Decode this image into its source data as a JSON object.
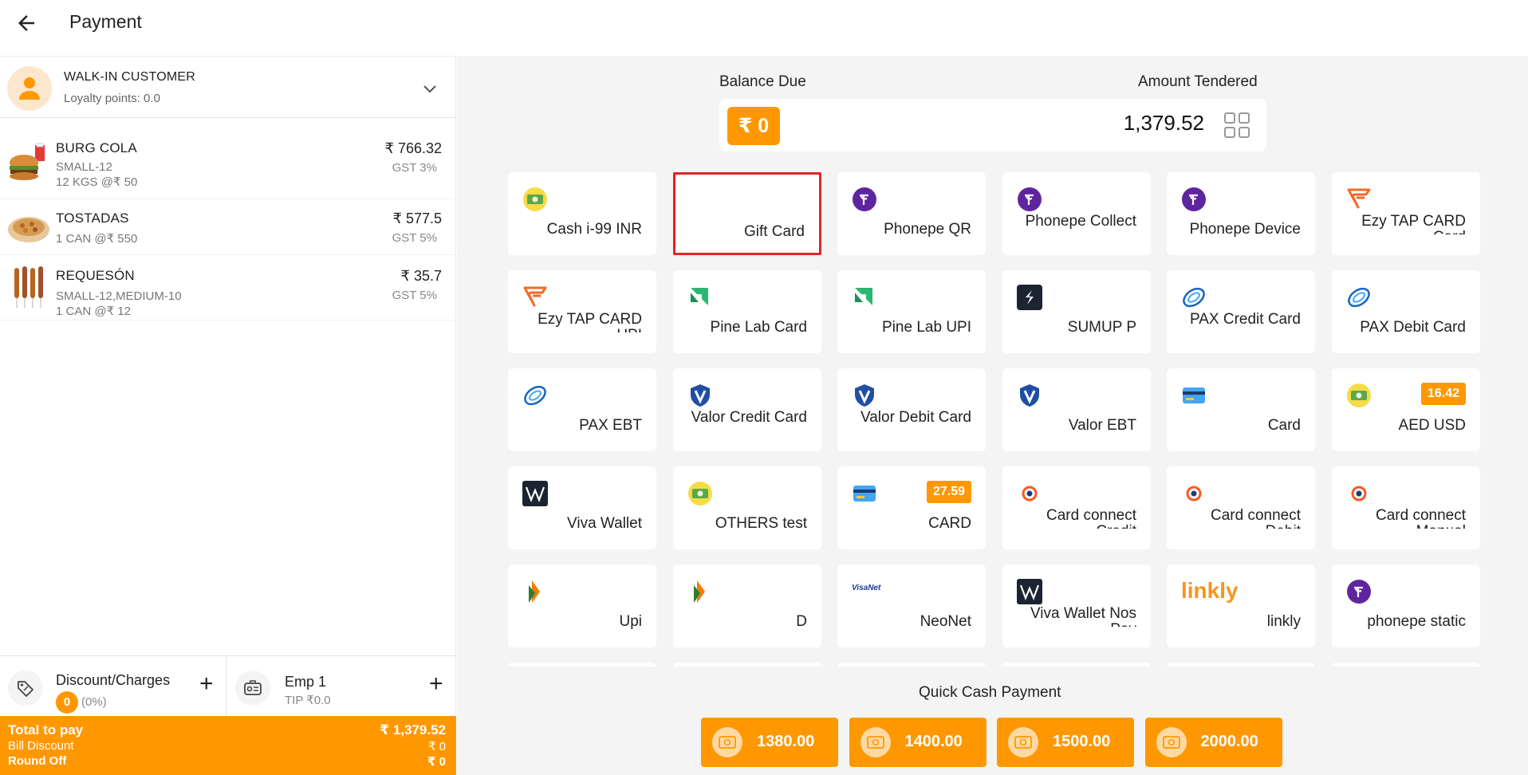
{
  "header": {
    "title": "Payment"
  },
  "customer": {
    "name": "WALK-IN CUSTOMER",
    "loyalty": "Loyalty points: 0.0"
  },
  "items": [
    {
      "name": "BURG COLA",
      "sub1": "SMALL-12",
      "sub2": "12 KGS @₹ 50",
      "price": "₹ 766.32",
      "gst": "GST 3%"
    },
    {
      "name": "TOSTADAS",
      "sub1": "1 CAN @₹ 550",
      "sub2": "",
      "price": "₹ 577.5",
      "gst": "GST 5%"
    },
    {
      "name": "REQUESÓN",
      "sub1": "SMALL-12,MEDIUM-10",
      "sub2": "1 CAN @₹ 12",
      "price": "₹ 35.7",
      "gst": "GST 5%"
    }
  ],
  "discount": {
    "label": "Discount/Charges",
    "count": "0",
    "percent": "(0%)"
  },
  "employee": {
    "name": "Emp 1",
    "tip": "TIP ₹0.0"
  },
  "totals": {
    "total_label": "Total to pay",
    "total_value": "₹ 1,379.52",
    "discount_label": "Bill Discount",
    "discount_value": "₹ 0",
    "roundoff_label": "Round Off",
    "roundoff_value": "₹ 0"
  },
  "tender": {
    "balance_label": "Balance Due",
    "balance_value": "₹ 0",
    "tendered_label": "Amount Tendered",
    "tendered_value": "1,379.52"
  },
  "methods": [
    {
      "label": "Cash i-99 INR",
      "icon": "cash-icon",
      "selected": false
    },
    {
      "label": "Gift Card",
      "icon": "",
      "selected": true
    },
    {
      "label": "Phonepe QR",
      "icon": "phonepe-icon",
      "selected": false
    },
    {
      "label": "Phonepe Collect",
      "icon": "phonepe-icon",
      "selected": false
    },
    {
      "label": "Phonepe Device",
      "icon": "phonepe-icon",
      "selected": false
    },
    {
      "label": "Ezy TAP CARD Card",
      "icon": "ezytap-icon",
      "selected": false
    },
    {
      "label": "Ezy TAP CARD UPI",
      "icon": "ezytap-icon",
      "selected": false
    },
    {
      "label": "Pine Lab Card",
      "icon": "pinelab-icon",
      "selected": false
    },
    {
      "label": "Pine Lab UPI",
      "icon": "pinelab-icon",
      "selected": false
    },
    {
      "label": "SUMUP P",
      "icon": "sumup-icon",
      "selected": false
    },
    {
      "label": "PAX Credit Card",
      "icon": "pax-icon",
      "selected": false
    },
    {
      "label": "PAX Debit Card",
      "icon": "pax-icon",
      "selected": false
    },
    {
      "label": "PAX EBT",
      "icon": "pax-icon",
      "selected": false
    },
    {
      "label": "Valor Credit Card",
      "icon": "valor-icon",
      "selected": false
    },
    {
      "label": "Valor Debit Card",
      "icon": "valor-icon",
      "selected": false
    },
    {
      "label": "Valor EBT",
      "icon": "valor-icon",
      "selected": false
    },
    {
      "label": "Card",
      "icon": "card-icon",
      "selected": false
    },
    {
      "label": "AED USD",
      "icon": "cash-icon",
      "badge": "16.42",
      "selected": false
    },
    {
      "label": "Viva Wallet",
      "icon": "viva-icon",
      "selected": false
    },
    {
      "label": "OTHERS test",
      "icon": "cash-icon",
      "selected": false
    },
    {
      "label": "CARD",
      "icon": "card-icon",
      "badge": "27.59",
      "selected": false
    },
    {
      "label": "Card connect Credit",
      "icon": "cardconnect-icon",
      "selected": false
    },
    {
      "label": "Card connect Debit",
      "icon": "cardconnect-icon",
      "selected": false
    },
    {
      "label": "Card connect Manual",
      "icon": "cardconnect-icon",
      "selected": false
    },
    {
      "label": "Upi",
      "icon": "upi-icon",
      "selected": false
    },
    {
      "label": "D",
      "icon": "upi-icon",
      "selected": false
    },
    {
      "label": "NeoNet",
      "icon": "visanet-icon",
      "icon_text": "VisaNet",
      "selected": false
    },
    {
      "label": "Viva Wallet Nos Pay",
      "icon": "viva-icon",
      "selected": false
    },
    {
      "label": "linkly",
      "icon": "linkly-icon",
      "icon_text": "linkly",
      "selected": false
    },
    {
      "label": "phonepe static",
      "icon": "phonepe-icon",
      "selected": false
    }
  ],
  "quick_cash": {
    "title": "Quick Cash Payment",
    "amounts": [
      "1380.00",
      "1400.00",
      "1500.00",
      "2000.00"
    ]
  },
  "colors": {
    "accent": "#ff9800",
    "selected_border": "#e02424",
    "phonepe": "#5f259f",
    "valor": "#1f4fa3"
  }
}
